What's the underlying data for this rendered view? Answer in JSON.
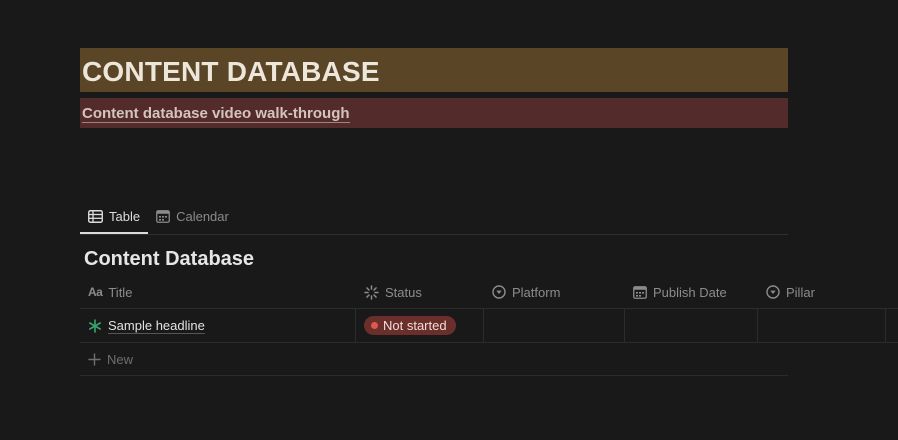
{
  "header": {
    "title": "CONTENT DATABASE",
    "walkthrough_link": "Content database video walk-through"
  },
  "tabs": [
    {
      "label": "Table",
      "icon": "table-icon",
      "active": true
    },
    {
      "label": "Calendar",
      "icon": "calendar-icon",
      "active": false
    }
  ],
  "database": {
    "title": "Content Database",
    "columns": [
      {
        "label": "Title",
        "icon": "text-aa-icon"
      },
      {
        "label": "Status",
        "icon": "status-spinner-icon"
      },
      {
        "label": "Platform",
        "icon": "select-chevron-icon"
      },
      {
        "label": "Publish Date",
        "icon": "calendar-icon"
      },
      {
        "label": "Pillar",
        "icon": "select-chevron-icon"
      }
    ],
    "rows": [
      {
        "title": "Sample headline",
        "icon": "asterisk-icon",
        "status": "Not started",
        "platform": "",
        "publish_date": "",
        "pillar": ""
      }
    ],
    "new_label": "New"
  },
  "colors": {
    "banner": "#5a4527",
    "sub_banner": "#542b2b",
    "status_not_started": "#6b2f2b",
    "status_dot": "#e0574f",
    "asterisk": "#3aa36f"
  }
}
